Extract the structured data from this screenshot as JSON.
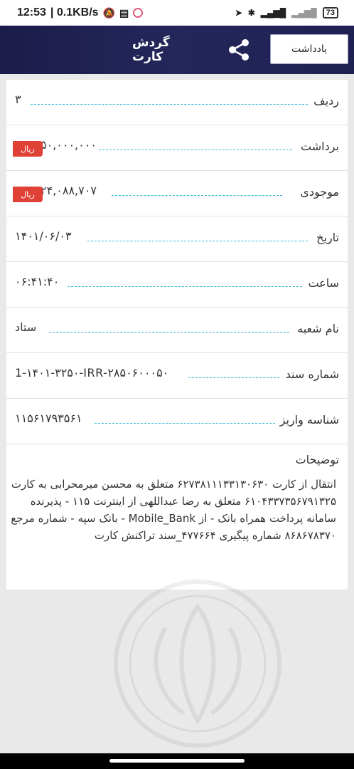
{
  "status_bar": {
    "time": "12:53",
    "speed": "| 0.1KB/s",
    "battery": "73"
  },
  "header": {
    "title": "گردش کارت",
    "note_button": "یادداشت"
  },
  "details": [
    {
      "label": "ردیف",
      "value": "۳",
      "currency": ""
    },
    {
      "label": "برداشت",
      "value": "۵۰,۰۰۰,۰۰۰",
      "currency": "ریال"
    },
    {
      "label": "موجودی",
      "value": "۲۴,۰۸۸,۷۰۷",
      "currency": "ریال"
    },
    {
      "label": "تاریخ",
      "value": "۱۴۰۱/۰۶/۰۳",
      "currency": ""
    },
    {
      "label": "ساعت",
      "value": "۰۶:۴۱:۴۰",
      "currency": ""
    },
    {
      "label": "نام شعبه",
      "value": "ستاد",
      "currency": ""
    },
    {
      "label": "شماره سند",
      "value": "1-۱۴۰۱-۳۲۵۰-IRR-۲۸۵۰۶۰۰۰۵۰",
      "currency": ""
    },
    {
      "label": "شناسه واریز",
      "value": "۱۱۵۶۱۷۹۳۵۶۱",
      "currency": ""
    }
  ],
  "description": {
    "label": "توضیحات",
    "text": "انتقال از کارت ۶۲۷۳۸۱۱۱۳۳۱۳۰۶۳۰ متعلق به محسن میرمحرابی به کارت ۶۱۰۴۳۳۷۳۵۶۷۹۱۳۲۵ متعلق به  رضا عبداللهی از اینترنت ۱۱۵ - پذیرنده سامانه پرداخت همراه بانک - از Mobile_Bank - بانک سپه - شماره مرجع ۸۶۸۶۷۸۳۷۰ شماره پیگیری ۴۷۷۶۶۴_سند تراکنش کارت"
  }
}
